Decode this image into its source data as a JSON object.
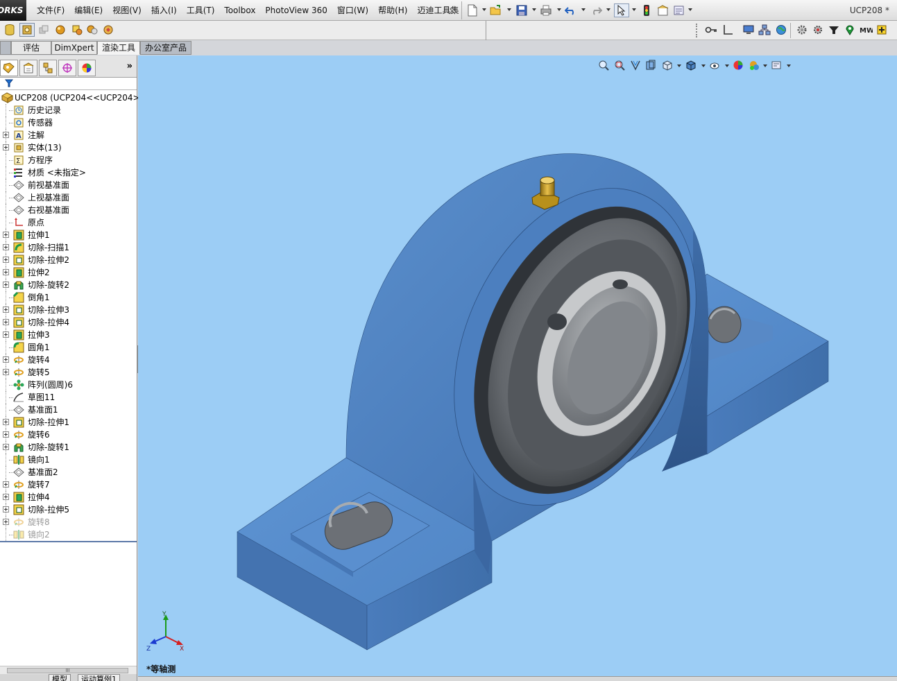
{
  "app": {
    "logo_text": "ORKS",
    "document_title": "UCP208 *"
  },
  "menu": {
    "items": [
      {
        "label": "文件(F)"
      },
      {
        "label": "编辑(E)"
      },
      {
        "label": "视图(V)"
      },
      {
        "label": "插入(I)"
      },
      {
        "label": "工具(T)"
      },
      {
        "label": "Toolbox"
      },
      {
        "label": "PhotoView 360"
      },
      {
        "label": "窗口(W)"
      },
      {
        "label": "帮助(H)"
      },
      {
        "label": "迈迪工具集"
      }
    ]
  },
  "command_tabs": [
    {
      "label": "评估"
    },
    {
      "label": "DimXpert"
    },
    {
      "label": "渲染工具"
    },
    {
      "label": "办公室产品"
    }
  ],
  "feature_tree": {
    "root": {
      "label": "UCP208  (UCP204<<UCP204>_"
    },
    "items": [
      {
        "label": "历史记录",
        "icon": "history-icon",
        "expandable": false
      },
      {
        "label": "传感器",
        "icon": "sensor-icon",
        "expandable": false
      },
      {
        "label": "注解",
        "icon": "annotation-icon",
        "expandable": true
      },
      {
        "label": "实体(13)",
        "icon": "solid-bodies-icon",
        "expandable": true
      },
      {
        "label": "方程序",
        "icon": "equation-icon",
        "expandable": false
      },
      {
        "label": "材质 <未指定>",
        "icon": "material-icon",
        "expandable": false
      },
      {
        "label": "前视基准面",
        "icon": "plane-icon",
        "expandable": false
      },
      {
        "label": "上视基准面",
        "icon": "plane-icon",
        "expandable": false
      },
      {
        "label": "右视基准面",
        "icon": "plane-icon",
        "expandable": false
      },
      {
        "label": "原点",
        "icon": "origin-icon",
        "expandable": false
      },
      {
        "label": "拉伸1",
        "icon": "extrude-icon",
        "expandable": true
      },
      {
        "label": "切除-扫描1",
        "icon": "sweep-cut-icon",
        "expandable": true
      },
      {
        "label": "切除-拉伸2",
        "icon": "extrude-cut-icon",
        "expandable": true
      },
      {
        "label": "拉伸2",
        "icon": "extrude-icon",
        "expandable": true
      },
      {
        "label": "切除-旋转2",
        "icon": "revolve-cut-icon",
        "expandable": true
      },
      {
        "label": "倒角1",
        "icon": "chamfer-icon",
        "expandable": false
      },
      {
        "label": "切除-拉伸3",
        "icon": "extrude-cut-icon",
        "expandable": true
      },
      {
        "label": "切除-拉伸4",
        "icon": "extrude-cut-icon",
        "expandable": true
      },
      {
        "label": "拉伸3",
        "icon": "extrude-icon",
        "expandable": true
      },
      {
        "label": "圆角1",
        "icon": "fillet-icon",
        "expandable": false
      },
      {
        "label": "旋转4",
        "icon": "revolve-icon",
        "expandable": true
      },
      {
        "label": "旋转5",
        "icon": "revolve-icon",
        "expandable": true
      },
      {
        "label": "阵列(圆周)6",
        "icon": "circular-pattern-icon",
        "expandable": false
      },
      {
        "label": "草图11",
        "icon": "sketch-icon",
        "expandable": false
      },
      {
        "label": "基准面1",
        "icon": "plane-icon",
        "expandable": false
      },
      {
        "label": "切除-拉伸1",
        "icon": "extrude-cut-icon",
        "expandable": true
      },
      {
        "label": "旋转6",
        "icon": "revolve-icon",
        "expandable": true
      },
      {
        "label": "切除-旋转1",
        "icon": "revolve-cut-icon",
        "expandable": true
      },
      {
        "label": "镜向1",
        "icon": "mirror-icon",
        "expandable": false
      },
      {
        "label": "基准面2",
        "icon": "plane-icon",
        "expandable": false
      },
      {
        "label": "旋转7",
        "icon": "revolve-icon",
        "expandable": true
      },
      {
        "label": "拉伸4",
        "icon": "extrude-icon",
        "expandable": true
      },
      {
        "label": "切除-拉伸5",
        "icon": "extrude-cut-icon",
        "expandable": true
      },
      {
        "label": "旋转8",
        "icon": "revolve-icon",
        "expandable": true,
        "suppressed": true
      },
      {
        "label": "镜向2",
        "icon": "mirror-icon",
        "expandable": false,
        "suppressed": true
      }
    ]
  },
  "viewport": {
    "view_label": "*等轴测",
    "background_color": "#9ccdf5",
    "model_color": "#4f86c6",
    "triad_labels": {
      "x": "X",
      "y": "Y",
      "z": "Z"
    }
  },
  "bottom_tabs": [
    {
      "label": "模型"
    },
    {
      "label": "运动算例1"
    }
  ],
  "scrollbar_label": "III"
}
